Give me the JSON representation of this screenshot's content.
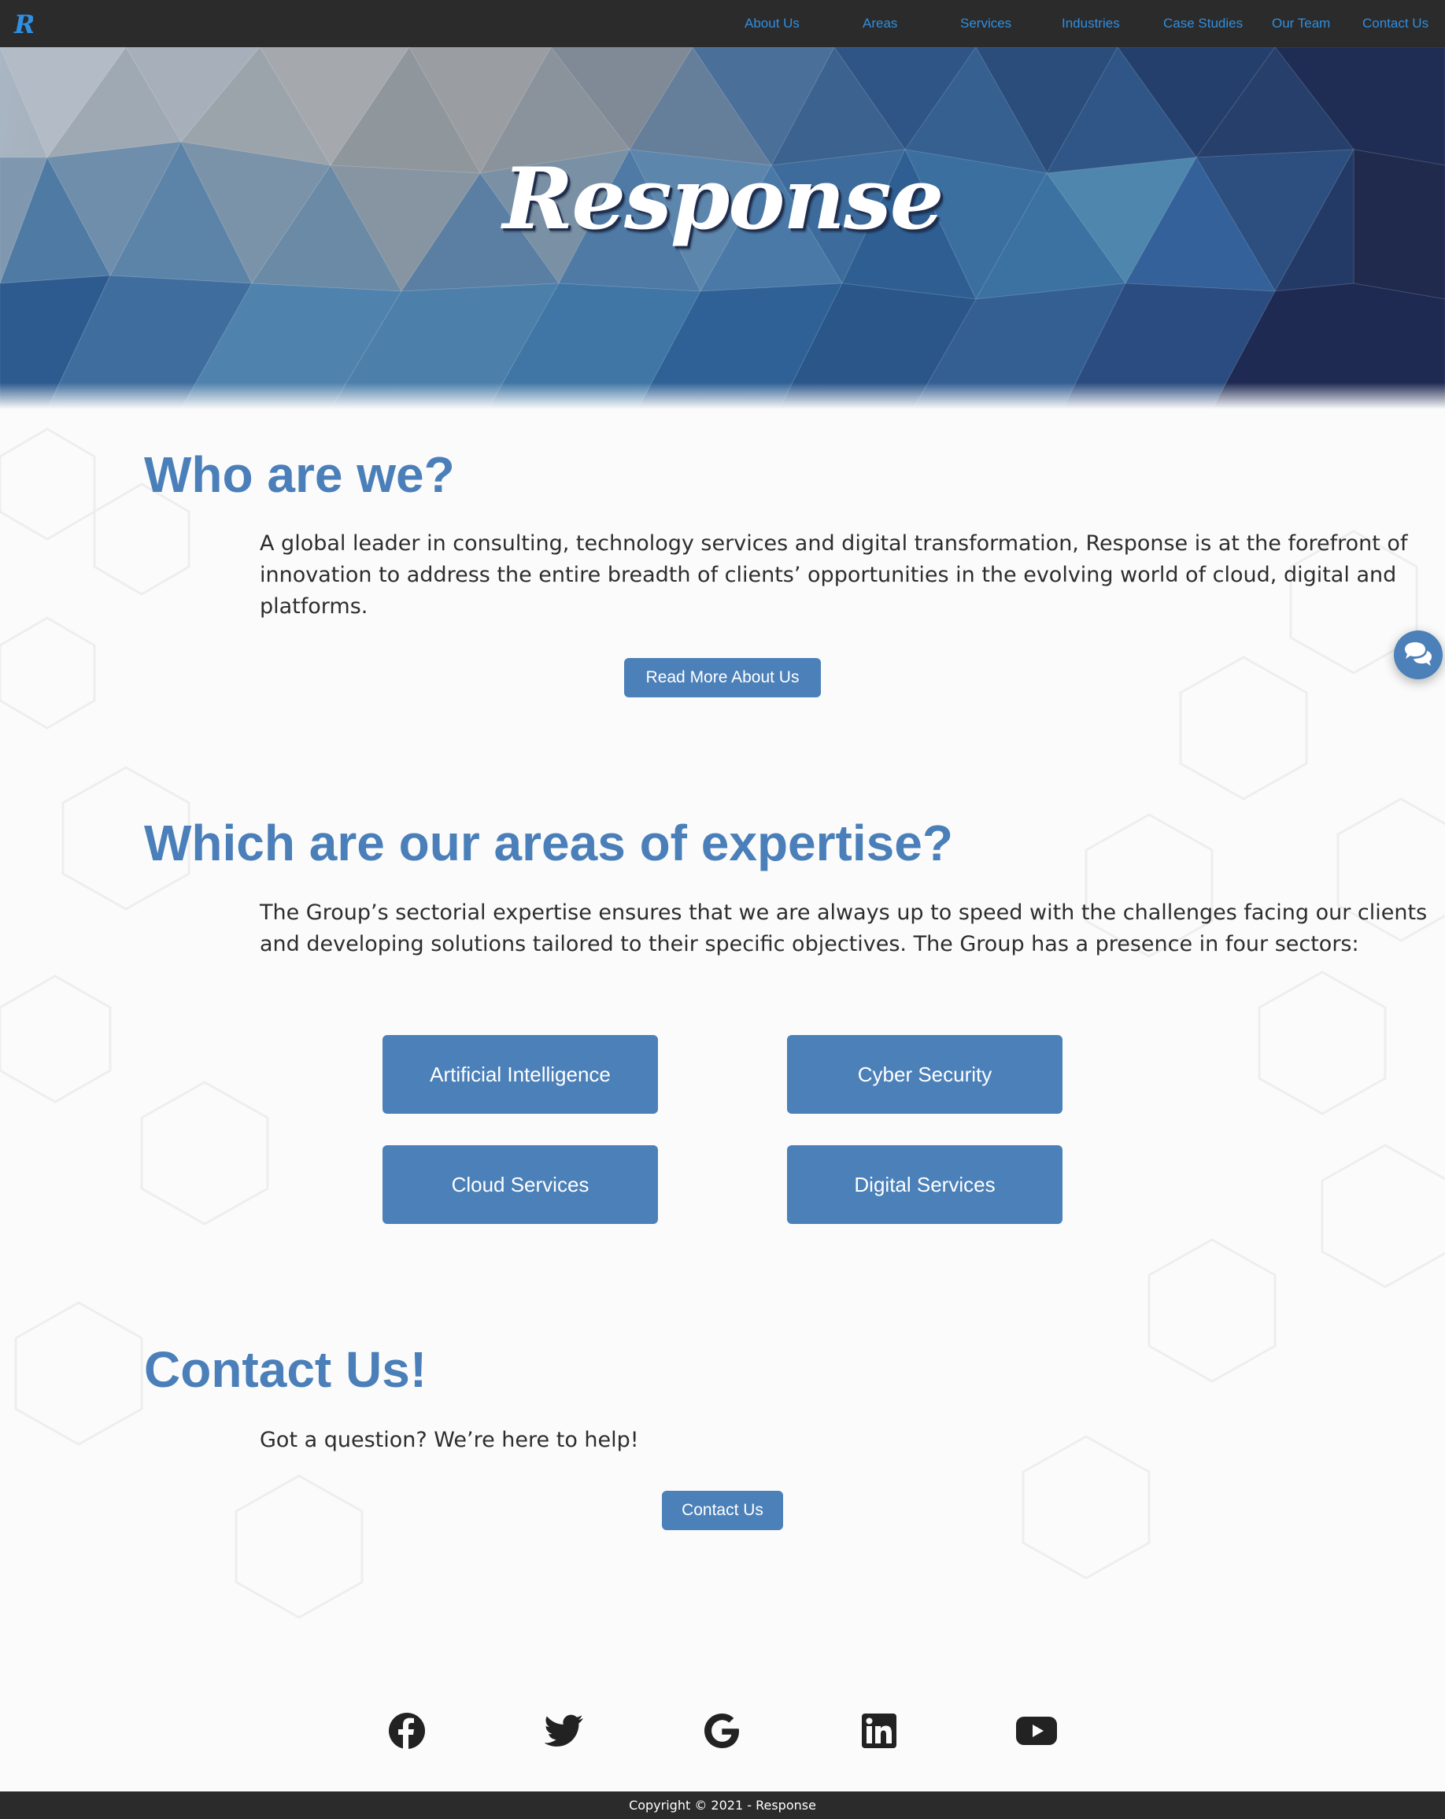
{
  "nav": {
    "brand_letter": "R",
    "links": [
      "About Us",
      "Areas",
      "Services",
      "Industries",
      "Case Studies",
      "Our Team",
      "Contact Us"
    ]
  },
  "hero": {
    "title": "Response"
  },
  "who": {
    "heading": "Who are we?",
    "text": "A global leader in consulting, technology services and digital transformation, Response is at the forefront of innovation to address the entire breadth of clients’ opportunities in the evolving world of cloud, digital and platforms.",
    "button": "Read More About Us"
  },
  "areas": {
    "heading": "Which are our areas of expertise?",
    "text": "The Group’s sectorial expertise ensures that we are always up to speed with the challenges facing our clients and developing solutions tailored to their specific objectives. The Group has a presence in four sectors:",
    "cards": [
      "Artificial Intelligence",
      "Cyber Security",
      "Cloud Services",
      "Digital Services"
    ]
  },
  "contact": {
    "heading": "Contact Us!",
    "text": "Got a question? We’re here to help!",
    "button": "Contact Us"
  },
  "social": [
    "facebook-icon",
    "twitter-icon",
    "google-icon",
    "linkedin-icon",
    "youtube-icon"
  ],
  "footer": {
    "copyright": "Copyright © 2021 - Response"
  },
  "colors": {
    "accent": "#4b80b9",
    "nav_link": "#2f8fe0",
    "dark": "#2b2b2b"
  }
}
